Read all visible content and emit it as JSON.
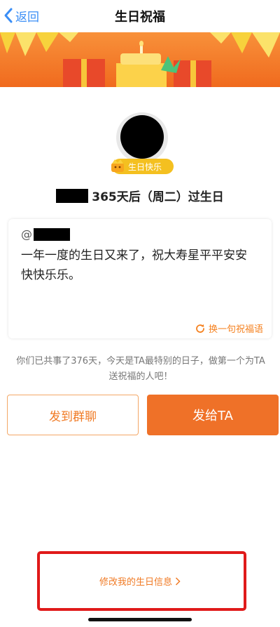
{
  "nav": {
    "back_label": "返回",
    "title": "生日祝福"
  },
  "profile": {
    "badge_label": "生日快乐"
  },
  "birthday_line": {
    "text": "365天后（周二）过生日"
  },
  "message": {
    "mention_prefix": "@",
    "blessing": "一年一度的生日又来了，祝大寿星平平安安快快乐乐。",
    "change_label": "换一句祝福语"
  },
  "info": {
    "text": "你们已共事了376天，今天是TA最特别的日子，做第一个为TA送祝福的人吧！"
  },
  "actions": {
    "send_group_label": "发到群聊",
    "send_ta_label": "发给TA"
  },
  "footer": {
    "modify_label": "修改我的生日信息"
  },
  "colors": {
    "accent_orange": "#ef7128",
    "link_blue": "#3a8ef6",
    "highlight_red": "#e01a1a",
    "badge_yellow": "#f4c020"
  }
}
